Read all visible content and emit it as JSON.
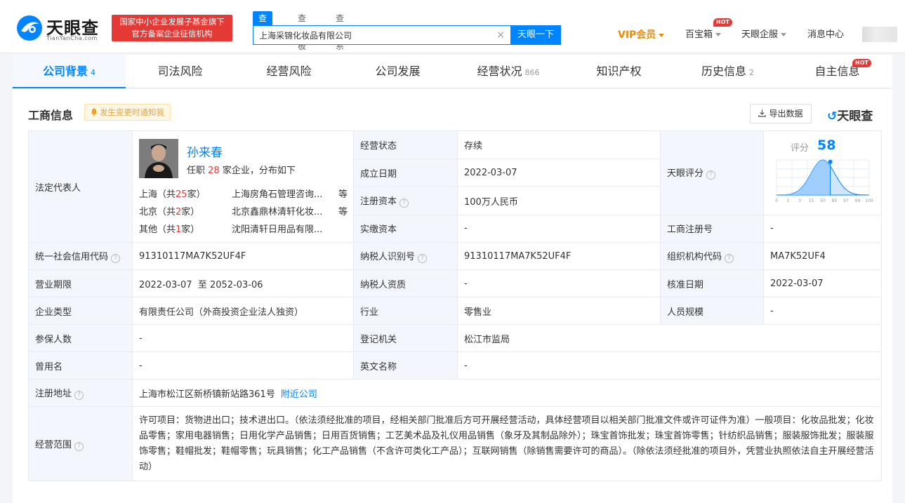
{
  "header": {
    "logo_text": "天眼查",
    "logo_sub": "TianYanCha.com",
    "fund_badge_line1": "国家中小企业发展子基金旗下",
    "fund_badge_line2": "官方备案企业征信机构",
    "search_tabs": [
      "查公司",
      "查老板",
      "查关系"
    ],
    "search_value": "上海采锦化妆品有限公司",
    "search_clear": "×",
    "search_button": "天眼一下",
    "vip_label": "VIP会员",
    "baibaoxiang_label": "百宝箱",
    "qiban_label": "天眼企服",
    "message_label": "消息中心",
    "hot_badge": "HOT"
  },
  "tabs": [
    {
      "label": "公司背景",
      "count": "4"
    },
    {
      "label": "司法风险",
      "count": ""
    },
    {
      "label": "经营风险",
      "count": ""
    },
    {
      "label": "公司发展",
      "count": ""
    },
    {
      "label": "经营状况",
      "count": "866"
    },
    {
      "label": "知识产权",
      "count": ""
    },
    {
      "label": "历史信息",
      "count": "2"
    },
    {
      "label": "自主信息",
      "count": ""
    }
  ],
  "section": {
    "title": "工商信息",
    "notify_label": "发生变更时通知我",
    "export_label": "导出数据",
    "brand_logo": "天眼查"
  },
  "legal_rep": {
    "label": "法定代表人",
    "name": "孙来春",
    "sub_prefix": "任职",
    "sub_count": "28",
    "sub_suffix": "家企业，分布如下",
    "regions": [
      {
        "city": "上海（共",
        "num": "25",
        "unit": "家）",
        "company": "上海房角石管理咨询...",
        "more": "等"
      },
      {
        "city": "北京（共",
        "num": "2",
        "unit": "家）",
        "company": "北京鑫鼎林清轩化妆...",
        "more": "等"
      },
      {
        "city": "其他（共",
        "num": "1",
        "unit": "家）",
        "company": "沈阳清轩日用品有限...",
        "more": ""
      }
    ]
  },
  "fields": {
    "status_label": "经营状态",
    "status_value": "存续",
    "found_label": "成立日期",
    "found_value": "2022-03-07",
    "capital_label": "注册资本",
    "capital_value": "100万人民币",
    "paid_label": "实缴资本",
    "paid_value": "-",
    "score_label": "天眼评分",
    "score_inner_label": "评分",
    "score_value": "58",
    "reg_no_label": "工商注册号",
    "reg_no_value": "-",
    "credit_code_label": "统一社会信用代码",
    "credit_code_value": "91310117MA7K52UF4F",
    "tax_id_label": "纳税人识别号",
    "tax_id_value": "91310117MA7K52UF4F",
    "org_code_label": "组织机构代码",
    "org_code_value": "MA7K52UF4",
    "term_label": "营业期限",
    "term_value": "2022-03-07  至 2052-03-06",
    "tax_qual_label": "纳税人资质",
    "tax_qual_value": "-",
    "approve_label": "核准日期",
    "approve_value": "2022-03-07",
    "type_label": "企业类型",
    "type_value": "有限责任公司（外商投资企业法人独资）",
    "industry_label": "行业",
    "industry_value": "零售业",
    "staff_label": "人员规模",
    "staff_value": "-",
    "insured_label": "参保人数",
    "insured_value": "-",
    "authority_label": "登记机关",
    "authority_value": "松江市监局",
    "former_label": "曾用名",
    "former_value": "-",
    "en_name_label": "英文名称",
    "en_name_value": "-",
    "address_label": "注册地址",
    "address_value": "上海市松江区新桥镇新站路361号",
    "nearby_label": "附近公司",
    "scope_label": "经营范围",
    "scope_value": "许可项目：货物进出口；技术进出口。（依法须经批准的项目，经相关部门批准后方可开展经营活动，具体经营项目以相关部门批准文件或许可证件为准）一般项目：化妆品批发；化妆品零售；家用电器销售；日用化学产品销售；日用百货销售；工艺美术品及礼仪用品销售（象牙及其制品除外）；珠宝首饰批发；珠宝首饰零售；针纺织品销售；服装服饰批发；服装服饰零售；鞋帽批发；鞋帽零售；玩具销售；化工产品销售（不含许可类化工产品）；互联网销售（除销售需要许可的商品）。（除依法须经批准的项目外，凭营业执照依法自主开展经营活动）"
  },
  "score_chart": {
    "type": "area",
    "x_ticks": [
      "0",
      "1",
      "3",
      "15",
      "50",
      "85",
      "97",
      "99",
      "100"
    ],
    "score": 58
  },
  "colors": {
    "accent": "#0084ff",
    "red": "#e53935",
    "vip": "#f08a00",
    "label_bg": "#f3f7fd"
  }
}
